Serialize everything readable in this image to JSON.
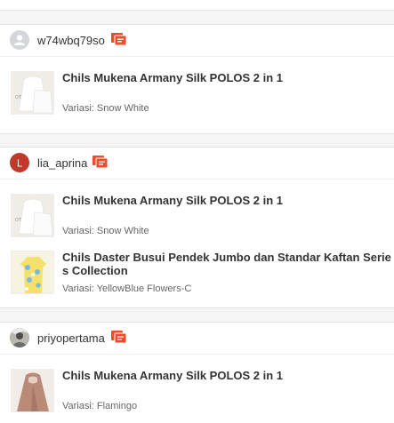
{
  "orders": [
    {
      "username": "w74wbq79so",
      "avatar_type": "default-user-icon",
      "items": [
        {
          "name": "Chils Mukena Armany Silk POLOS 2 in 1",
          "variant": "Variasi: Snow White",
          "thumb": "white-mukena"
        }
      ]
    },
    {
      "username": "lia_aprina",
      "avatar_type": "letter",
      "avatar_letter": "L",
      "items": [
        {
          "name": "Chils Mukena Armany Silk POLOS 2 in 1",
          "variant": "Variasi: Snow White",
          "thumb": "white-mukena"
        },
        {
          "name": "Chils Daster Busui Pendek Jumbo dan Standar Kaftan Series Collection",
          "variant": "Variasi: YellowBlue Flowers-C",
          "thumb": "floral-daster"
        }
      ]
    },
    {
      "username": "priyopertama",
      "avatar_type": "photo",
      "items": [
        {
          "name": "Chils Mukena Armany Silk POLOS 2 in 1",
          "variant": "Variasi: Flamingo",
          "thumb": "flamingo-mukena"
        }
      ]
    }
  ],
  "colors": {
    "chat": "#ee4d2d",
    "letter_avatar": "#c0392b",
    "default_avatar": "#d3d6db"
  }
}
